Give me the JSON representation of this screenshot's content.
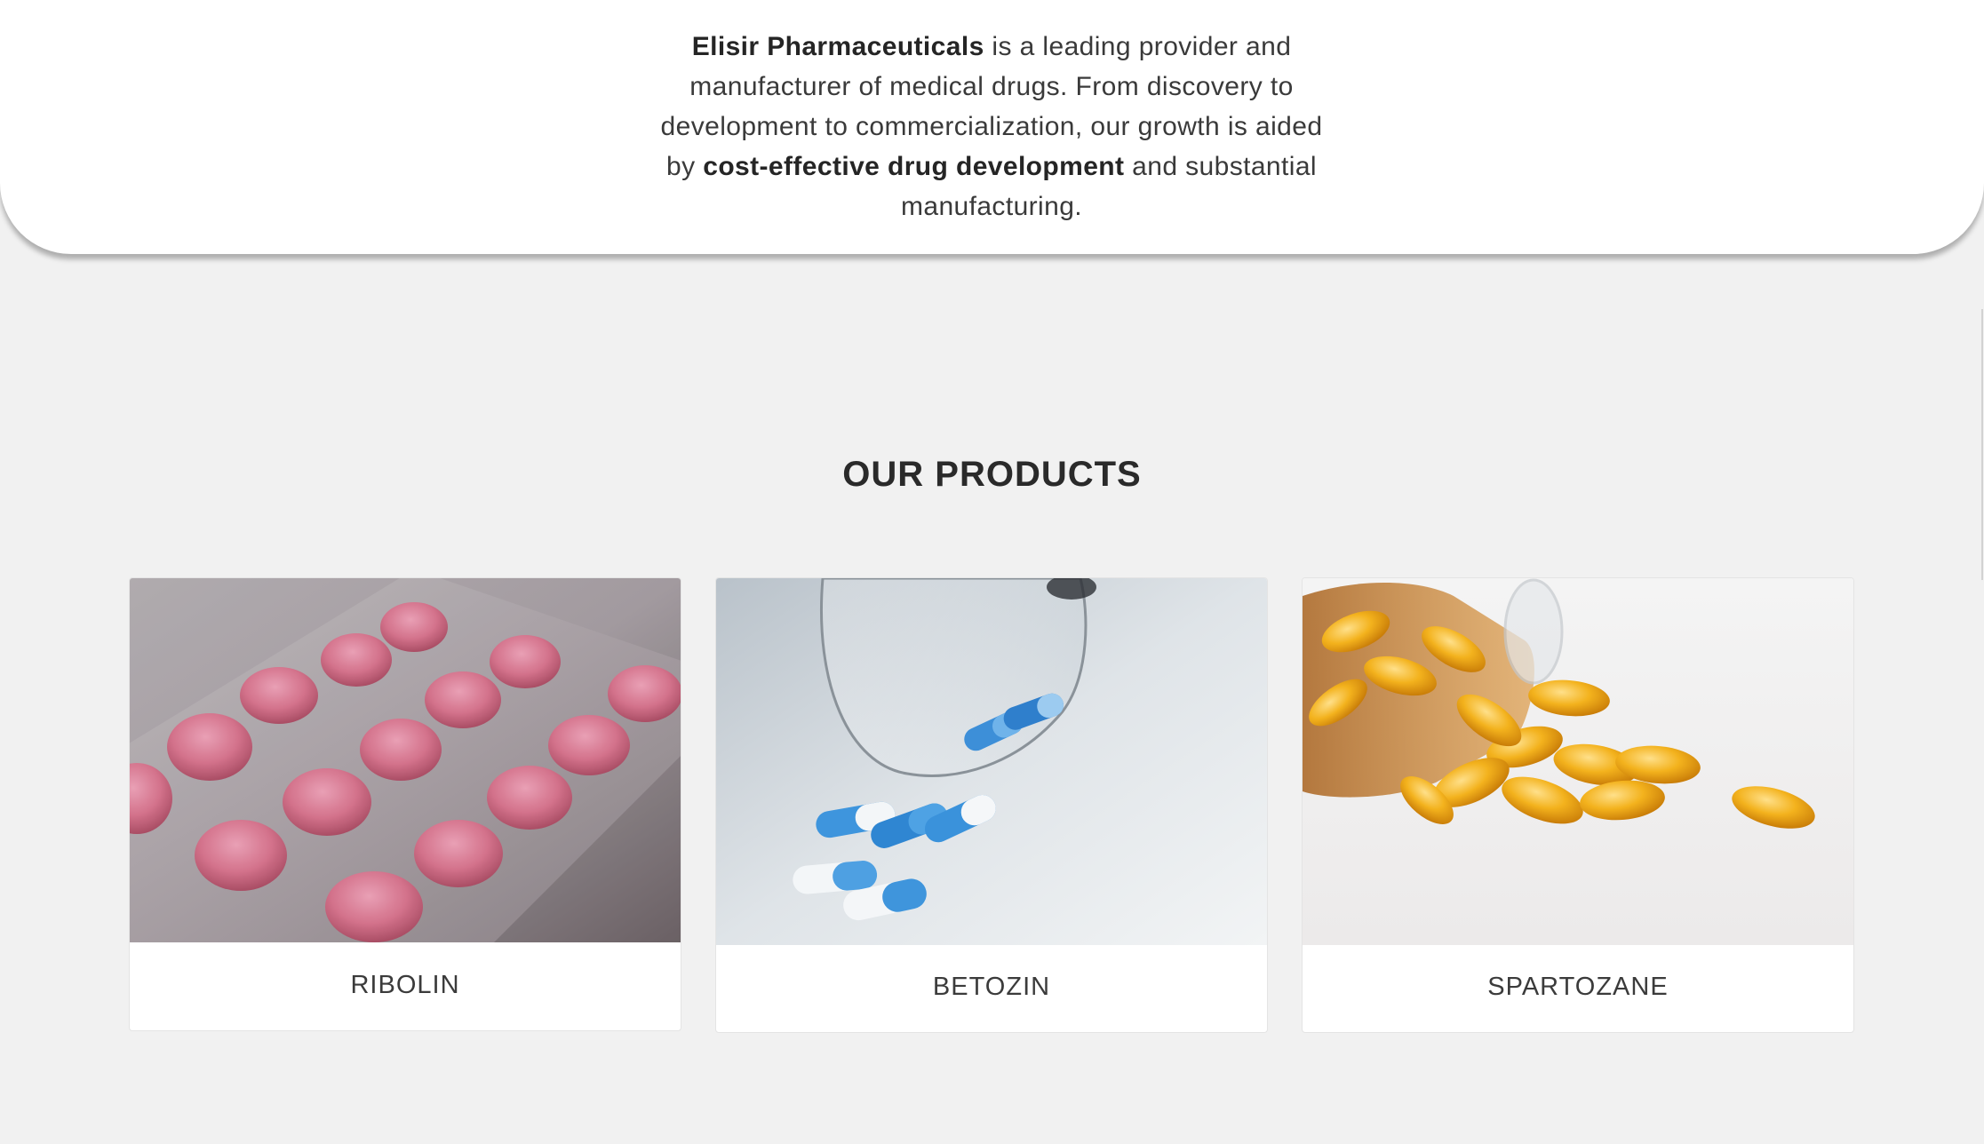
{
  "intro": {
    "company_name": "Elisir Pharmaceuticals",
    "text_1": " is a leading provider and manufacturer of medical drugs. From discovery to development to commercialization, our growth is aided by ",
    "highlight": "cost-effective drug development",
    "text_2": " and substantial manufacturing."
  },
  "products": {
    "title": "OUR PRODUCTS",
    "items": [
      {
        "name": "RIBOLIN",
        "image_icon": "pink-tablets-blister-image"
      },
      {
        "name": "BETOZIN",
        "image_icon": "blue-capsules-glass-image"
      },
      {
        "name": "SPARTOZANE",
        "image_icon": "amber-softgels-bottle-image"
      }
    ]
  },
  "colors": {
    "background": "#f1f1f1",
    "card": "#ffffff",
    "text": "#2b2b2b"
  }
}
